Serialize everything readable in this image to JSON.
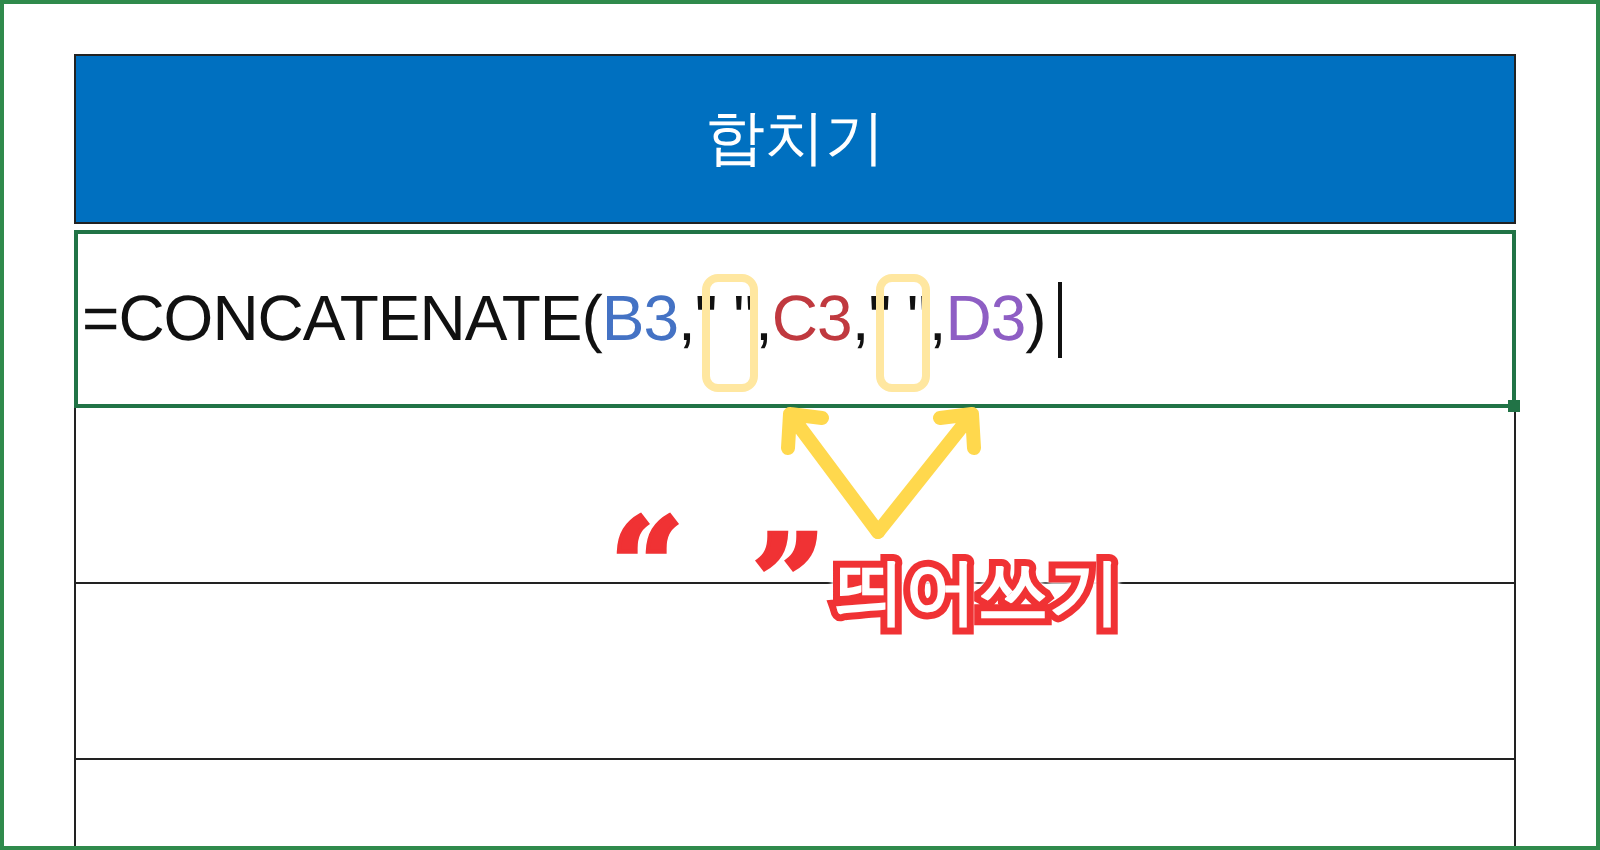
{
  "header": {
    "title": "합치기"
  },
  "formula_cell": {
    "selected": true,
    "editing": true,
    "tokens": [
      {
        "kind": "plain",
        "text": "=CONCATENATE("
      },
      {
        "kind": "ref",
        "text": "B3",
        "color": "#4472c4"
      },
      {
        "kind": "plain",
        "text": ","
      },
      {
        "kind": "string",
        "text": "\" \"",
        "highlighted": true
      },
      {
        "kind": "plain",
        "text": ","
      },
      {
        "kind": "ref",
        "text": "C3",
        "color": "#c0393f"
      },
      {
        "kind": "plain",
        "text": ","
      },
      {
        "kind": "string",
        "text": "\" \"",
        "highlighted": true
      },
      {
        "kind": "plain",
        "text": ","
      },
      {
        "kind": "ref",
        "text": "D3",
        "color": "#8e5ec4"
      },
      {
        "kind": "plain",
        "text": ")"
      }
    ]
  },
  "annotation": {
    "open_quote": "“",
    "close_quote": "”",
    "label": "띄어쓰기"
  }
}
